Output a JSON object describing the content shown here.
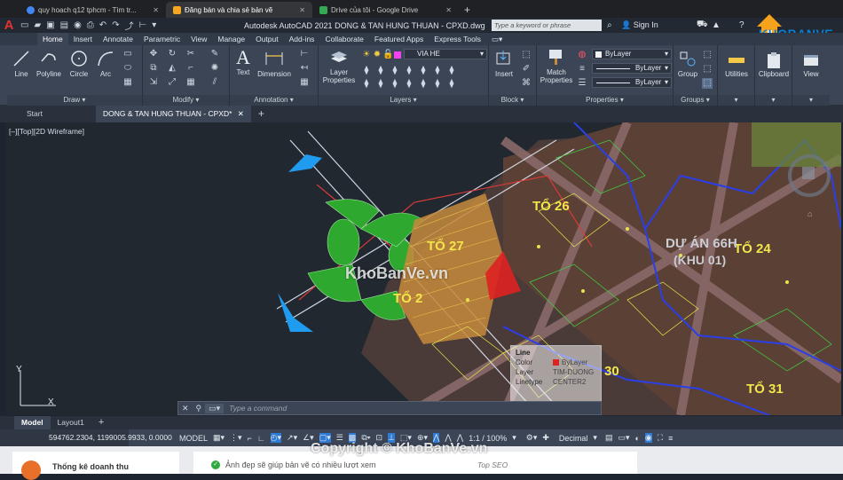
{
  "browser": {
    "tabs": [
      {
        "label": "quy hoach q12 tphcm - Tìm tr...",
        "fav_color": "#4285f4"
      },
      {
        "label": "Đăng bán và chia sẻ bản vẽ",
        "fav_color": "#f5a623"
      },
      {
        "label": "Drive của tôi - Google Drive",
        "fav_color": "#34a853"
      }
    ],
    "new_tab": "+"
  },
  "app": {
    "logo": "A",
    "title": "Autodesk AutoCAD 2021   DONG & TAN HUNG THUAN - CPXD.dwg",
    "search_placeholder": "Type a keyword or phrase",
    "sign_in": "Sign In"
  },
  "ribbon": {
    "tabs": [
      "Home",
      "Insert",
      "Annotate",
      "Parametric",
      "View",
      "Manage",
      "Output",
      "Add-ins",
      "Collaborate",
      "Featured Apps",
      "Express Tools"
    ],
    "active_tab": "Home",
    "draw": {
      "label": "Draw",
      "line": "Line",
      "polyline": "Polyline",
      "circle": "Circle",
      "arc": "Arc"
    },
    "modify": {
      "label": "Modify"
    },
    "annotation": {
      "label": "Annotation",
      "text": "Text",
      "dimension": "Dimension"
    },
    "layers": {
      "label": "Layers",
      "layer_properties": "Layer Properties",
      "current_layer": "VIA HE"
    },
    "block": {
      "label": "Block",
      "insert": "Insert"
    },
    "properties": {
      "label": "Properties",
      "match": "Match Properties",
      "color": "ByLayer",
      "linetype": "ByLayer",
      "lineweight": "ByLayer"
    },
    "groups": {
      "label": "Groups",
      "group": "Group"
    },
    "utilities": "Utilities",
    "clipboard": "Clipboard",
    "view": "View"
  },
  "doc_tabs": {
    "start": "Start",
    "drawing": "DONG & TAN HUNG THUAN - CPXD*",
    "add": "+"
  },
  "viewport": {
    "label": "[–][Top][2D Wireframe]"
  },
  "drawing_labels": {
    "to26": "TỔ 26",
    "to27": "TỔ 27",
    "to24": "TỔ 24",
    "to30": "30",
    "to31": "TỔ 31",
    "to28": "TỔ 2",
    "duan": "DỰ ÁN 66H",
    "khu": "(KHU 01)"
  },
  "watermarks": {
    "center": "KhoBanVe.vn",
    "bottom": "Copyright © KhoBanVe.vn"
  },
  "tooltip": {
    "title": "Line",
    "rows": [
      {
        "key": "Color",
        "value": "ByLayer"
      },
      {
        "key": "Layer",
        "value": "TIM-DUONG"
      },
      {
        "key": "Linetype",
        "value": "CENTER2"
      }
    ]
  },
  "command": {
    "placeholder": "Type a command"
  },
  "ucs": {
    "x": "X",
    "y": "Y"
  },
  "layout_tabs": [
    "Model",
    "Layout1"
  ],
  "status": {
    "coords": "594762.2304, 1199005.9933, 0.0000",
    "model": "MODEL",
    "scale": "1:1 / 100%",
    "units": "Decimal"
  },
  "web": {
    "left_text": "Thống kê doanh thu",
    "center_text": "Ảnh đẹp sẽ giúp bản vẽ có nhiều lượt xem",
    "right_text": "Top SEO"
  },
  "brand": {
    "name": "KHOBANVE"
  },
  "colors": {
    "accent_red": "#e0322e",
    "ribbon_bg": "#3b4556",
    "canvas_bg": "#212830"
  }
}
